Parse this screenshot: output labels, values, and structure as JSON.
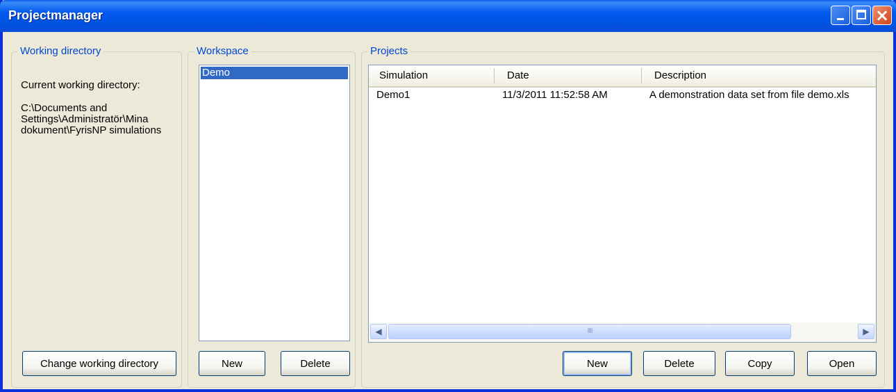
{
  "window": {
    "title": "Projectmanager",
    "close_glyph": "×"
  },
  "working_directory": {
    "legend": "Working directory",
    "current_label": "Current working directory:",
    "path": "C:\\Documents and Settings\\Administratör\\Mina dokument\\FyrisNP simulations",
    "change_button": "Change working directory"
  },
  "workspace": {
    "legend": "Workspace",
    "items": [
      "Demo"
    ],
    "selected": "Demo",
    "new_button": "New",
    "delete_button": "Delete"
  },
  "projects": {
    "legend": "Projects",
    "columns": [
      "Simulation",
      "Date",
      "Description"
    ],
    "rows": [
      {
        "simulation": "Demo1",
        "date": "11/3/2011 11:52:58 AM",
        "description": "A demonstration data set from file demo.xls"
      }
    ],
    "scroll_left": "◀",
    "scroll_right": "▶",
    "thumb_grip": "IIII",
    "new_button": "New",
    "delete_button": "Delete",
    "copy_button": "Copy",
    "open_button": "Open"
  },
  "colors": {
    "titlebar": "#0054e3",
    "selection": "#316ac5",
    "group_legend": "#0046d5",
    "window_bg": "#ece9d8"
  }
}
